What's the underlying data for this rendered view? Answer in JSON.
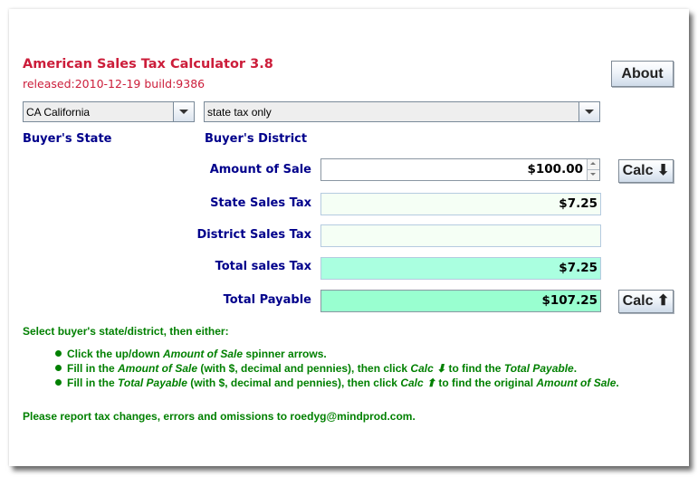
{
  "app": {
    "title": "American Sales Tax Calculator 3.8",
    "release": "released:2010-12-19 build:9386"
  },
  "toolbar": {
    "about_label": "About"
  },
  "selectors": {
    "state": {
      "value": "CA California",
      "label": "Buyer's State"
    },
    "district": {
      "value": "state tax only",
      "label": "Buyer's District"
    }
  },
  "form": {
    "amount_of_sale": {
      "label": "Amount of Sale",
      "value": "$100.00"
    },
    "state_sales_tax": {
      "label": "State Sales Tax",
      "value": "$7.25"
    },
    "district_sales_tax": {
      "label": "District Sales Tax",
      "value": ""
    },
    "total_sales_tax": {
      "label": "Total sales Tax",
      "value": "$7.25"
    },
    "total_payable": {
      "label": "Total Payable",
      "value": "$107.25"
    },
    "calc_down_label": "Calc ⬇",
    "calc_up_label": "Calc ⬆"
  },
  "instructions": {
    "intro": "Select buyer's state/district, then either:",
    "bullets": [
      {
        "parts": [
          "Click the up/down ",
          "Amount of Sale",
          " spinner arrows."
        ]
      },
      {
        "parts": [
          "Fill in the ",
          "Amount of Sale",
          " (with $, decimal and pennies), then click ",
          "Calc ⬇",
          " to find the ",
          "Total Payable",
          "."
        ]
      },
      {
        "parts": [
          "Fill in the ",
          "Total Payable",
          " (with $, decimal and pennies), then click ",
          "Calc ⬆",
          " to find the original ",
          "Amount of Sale",
          "."
        ]
      }
    ],
    "footer": "Please report tax changes, errors and omissions to roedyg@mindprod.com."
  },
  "colors": {
    "title": "#cc1d3a",
    "label": "#00008b",
    "instructions": "#008000",
    "field_light": "#f5fff5",
    "field_total_tax": "#aaffdd",
    "field_total_payable": "#99ffcc"
  }
}
